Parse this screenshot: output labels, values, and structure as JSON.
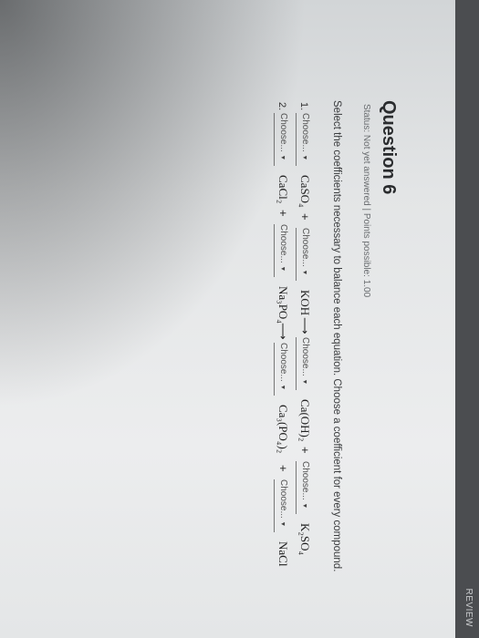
{
  "header": {
    "tab_label": "REVIEW"
  },
  "question": {
    "title": "Question 6",
    "status": "Status: Not yet answered | Points possible: 1.00",
    "instructions": "Select the coefficients necessary to balance each equation. Choose a coefficient for every compound."
  },
  "select_placeholder": "Choose...",
  "equations": [
    {
      "number": "1.",
      "compounds": [
        "CaSO₄",
        "KOH",
        "Ca(OH)₂",
        "K₂SO₄"
      ],
      "plus": "+",
      "arrow": "⟶"
    },
    {
      "number": "2.",
      "compounds": [
        "CaCl₂",
        "Na₃PO₄",
        "Ca₃(PO₄)₂",
        "NaCl"
      ],
      "plus": "+",
      "arrow": "⟶"
    }
  ]
}
